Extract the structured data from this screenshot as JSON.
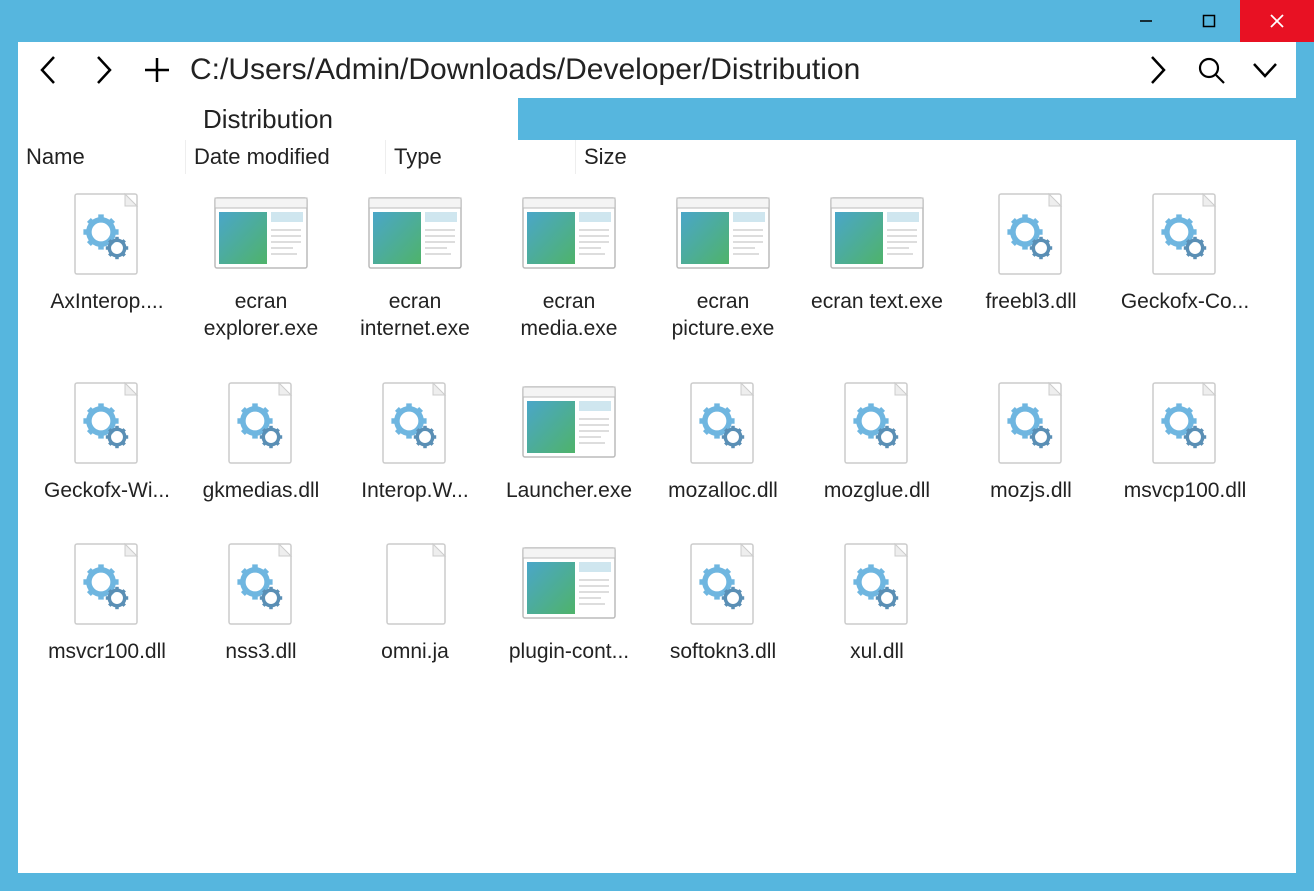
{
  "navbar": {
    "path": "C:/Users/Admin/Downloads/Developer/Distribution"
  },
  "tab": {
    "label": "Distribution"
  },
  "columns": {
    "name": "Name",
    "date": "Date modified",
    "type": "Type",
    "size": "Size"
  },
  "files": [
    {
      "label": "AxInterop....",
      "icon": "dll"
    },
    {
      "label": "ecran explorer.exe",
      "icon": "exe"
    },
    {
      "label": "ecran internet.exe",
      "icon": "exe"
    },
    {
      "label": "ecran media.exe",
      "icon": "exe"
    },
    {
      "label": "ecran picture.exe",
      "icon": "exe"
    },
    {
      "label": "ecran text.exe",
      "icon": "exe"
    },
    {
      "label": "freebl3.dll",
      "icon": "dll"
    },
    {
      "label": "Geckofx-Co...",
      "icon": "dll"
    },
    {
      "label": "Geckofx-Wi...",
      "icon": "dll"
    },
    {
      "label": "gkmedias.dll",
      "icon": "dll"
    },
    {
      "label": "Interop.W...",
      "icon": "dll"
    },
    {
      "label": "Launcher.exe",
      "icon": "exe"
    },
    {
      "label": "mozalloc.dll",
      "icon": "dll"
    },
    {
      "label": "mozglue.dll",
      "icon": "dll"
    },
    {
      "label": "mozjs.dll",
      "icon": "dll"
    },
    {
      "label": "msvcp100.dll",
      "icon": "dll"
    },
    {
      "label": "msvcr100.dll",
      "icon": "dll"
    },
    {
      "label": "nss3.dll",
      "icon": "dll"
    },
    {
      "label": "omni.ja",
      "icon": "blank"
    },
    {
      "label": "plugin-cont...",
      "icon": "exe"
    },
    {
      "label": "softokn3.dll",
      "icon": "dll"
    },
    {
      "label": "xul.dll",
      "icon": "dll"
    }
  ]
}
